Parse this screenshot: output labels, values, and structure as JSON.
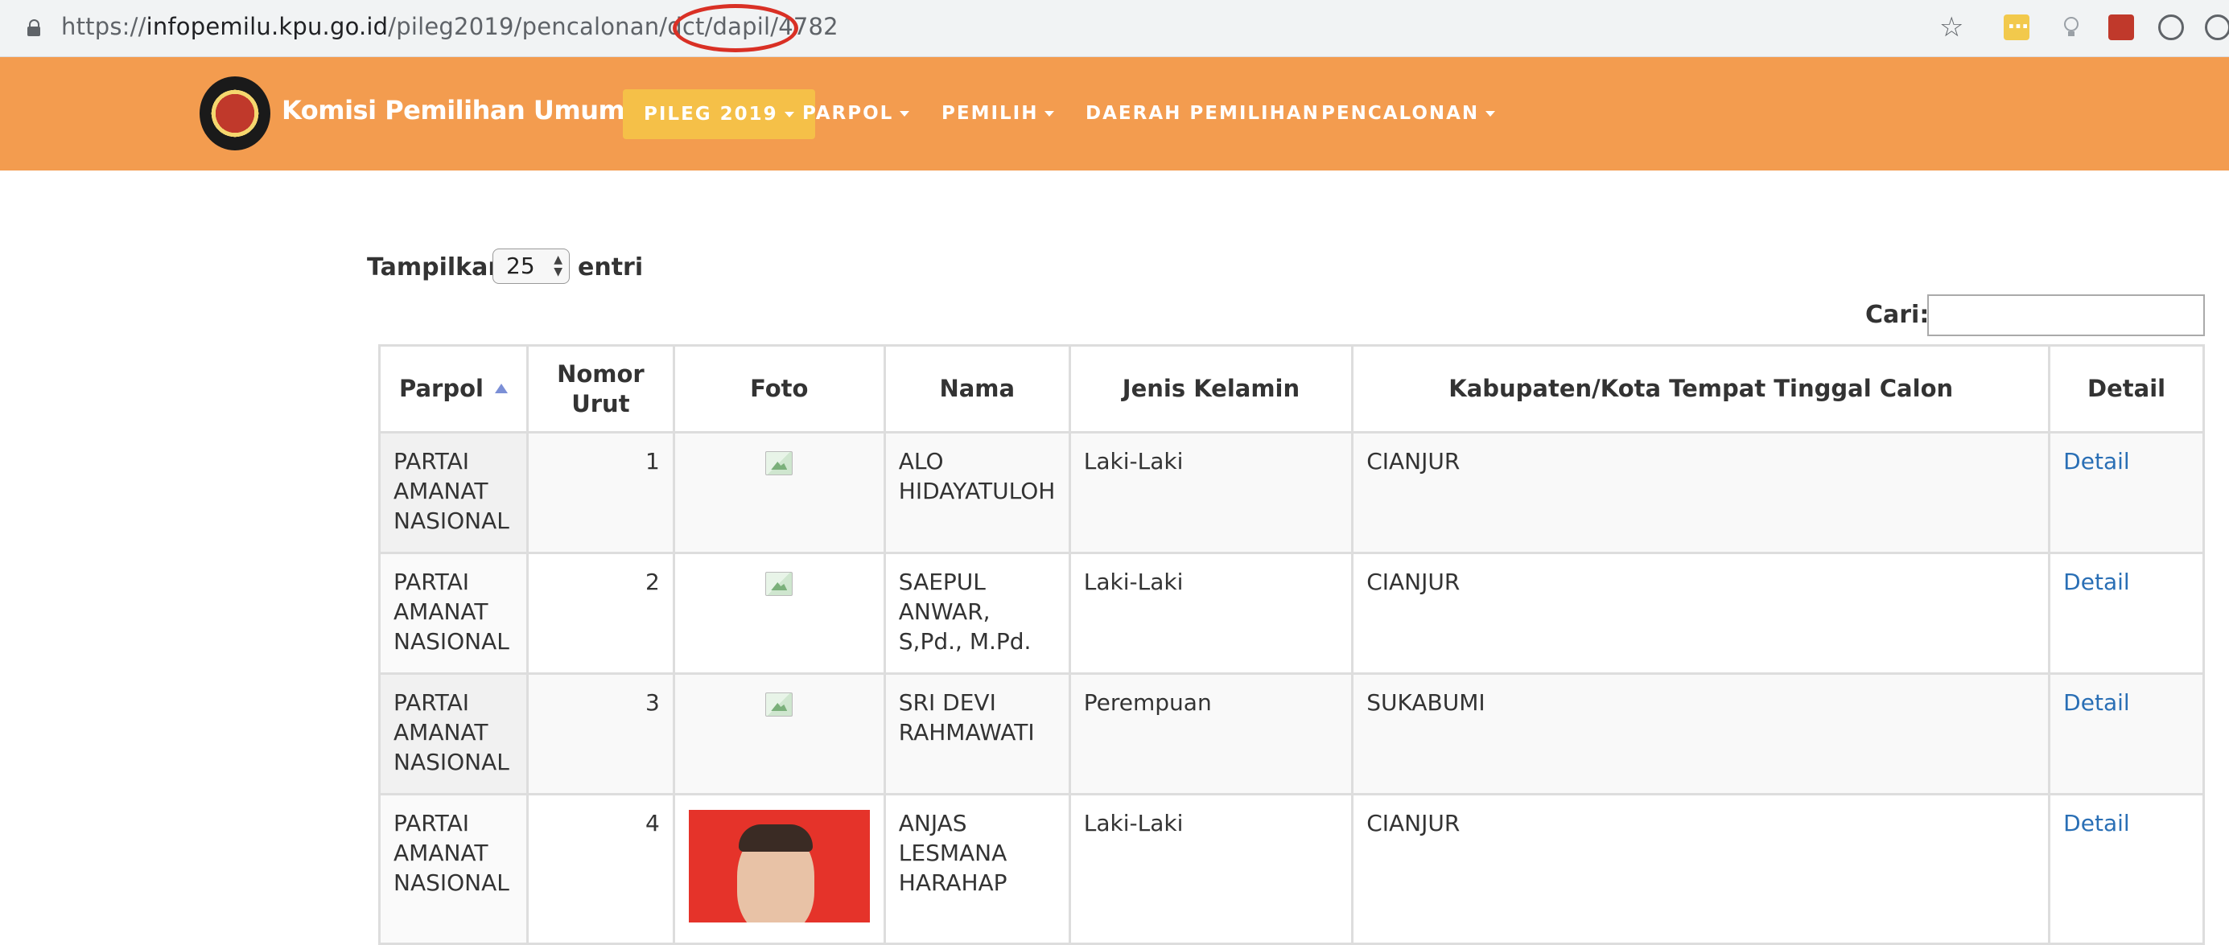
{
  "browser": {
    "url_prefix": "https://",
    "url_host": "infopemilu.kpu.go.id",
    "url_path": "/pileg2019/pencalonan/dct/dapil/4782",
    "icons": [
      "lock-icon",
      "star-icon",
      "extension-icons"
    ]
  },
  "navbar": {
    "brand": "Komisi Pemilihan Umum",
    "items": [
      {
        "label": "PILEG 2019",
        "active": true
      },
      {
        "label": "PARPOL"
      },
      {
        "label": "PEMILIH"
      },
      {
        "label": "DAERAH PEMILIHAN"
      },
      {
        "label": "PENCALONAN"
      }
    ],
    "colors": {
      "bar": "#f39c4f",
      "active": "#f5c048"
    }
  },
  "controls": {
    "show_label": "Tampilkan",
    "show_value": "25",
    "entries_label": "entri",
    "search_label": "Cari:",
    "search_value": ""
  },
  "table": {
    "headers": [
      "Parpol",
      "Nomor Urut",
      "Foto",
      "Nama",
      "Jenis Kelamin",
      "Kabupaten/Kota Tempat Tinggal Calon",
      "Detail"
    ],
    "rows": [
      {
        "parpol": "PARTAI AMANAT NASIONAL",
        "nomor": "1",
        "nama": "ALO HIDAYATULOH",
        "jenis_kelamin": "Laki-Laki",
        "kota": "CIANJUR",
        "detail": "Detail"
      },
      {
        "parpol": "PARTAI AMANAT NASIONAL",
        "nomor": "2",
        "nama": "SAEPUL ANWAR, S,Pd., M.Pd.",
        "jenis_kelamin": "Laki-Laki",
        "kota": "CIANJUR",
        "detail": "Detail"
      },
      {
        "parpol": "PARTAI AMANAT NASIONAL",
        "nomor": "3",
        "nama": "SRI DEVI RAHMAWATI",
        "jenis_kelamin": "Perempuan",
        "kota": "SUKABUMI",
        "detail": "Detail"
      },
      {
        "parpol": "PARTAI AMANAT NASIONAL",
        "nomor": "4",
        "nama": "ANJAS LESMANA HARAHAP",
        "jenis_kelamin": "Laki-Laki",
        "kota": "CIANJUR",
        "detail": "Detail"
      }
    ],
    "link_color": "#2a6fb5"
  }
}
